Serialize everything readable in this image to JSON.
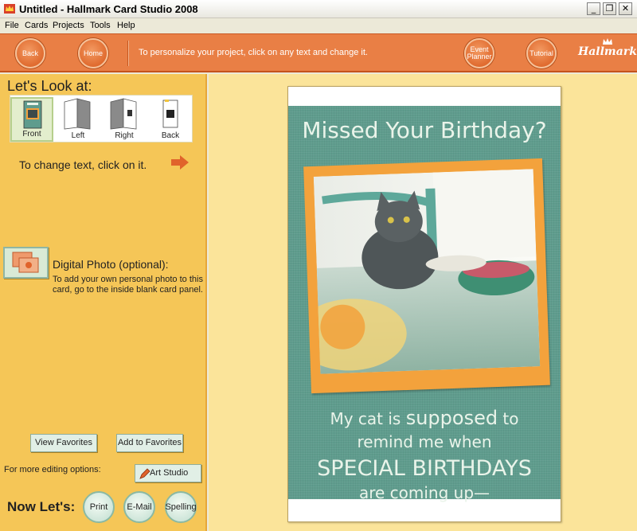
{
  "window": {
    "title": "Untitled - Hallmark Card Studio 2008",
    "minimize_glyph": "_",
    "restore_glyph": "❐",
    "close_glyph": "✕"
  },
  "menu": [
    "File",
    "Cards",
    "Projects",
    "Tools",
    "Help"
  ],
  "toolbar": {
    "back_label": "Back",
    "home_label": "Home",
    "message": "To personalize your project, click on any text and change it.",
    "event_planner_label": "Event Planner",
    "tutorial_label": "Tutorial",
    "brand": "Hallmark"
  },
  "left": {
    "look_title": "Let's Look at:",
    "views": [
      {
        "label": "Front",
        "selected": true
      },
      {
        "label": "Left",
        "selected": false
      },
      {
        "label": "Right",
        "selected": false
      },
      {
        "label": "Back",
        "selected": false
      }
    ],
    "change_text": "To change text, click on it.",
    "photo_title": "Digital Photo (optional):",
    "photo_desc": "To add your own personal photo to this card, go to the inside blank card panel.",
    "view_favorites": "View Favorites",
    "add_favorites": "Add to Favorites",
    "more_options": "For more editing options:",
    "art_studio": "Art Studio",
    "now_lets": "Now Let's:",
    "print": "Print",
    "email": "E-Mail",
    "spelling": "Spelling"
  },
  "card": {
    "headline": "Missed Your Birthday?",
    "line1_a": "My cat is ",
    "line1_b": "supposed",
    "line1_c": " to",
    "line2": "remind me when",
    "line3": "SPECIAL BIRTHDAYS",
    "line4": "are coming up—"
  },
  "colors": {
    "toolbar_orange": "#e97f45",
    "left_panel": "#f5c657",
    "workspace": "#fbe49a",
    "card_teal": "#5f9c8d",
    "frame_orange": "#f3a23c"
  }
}
